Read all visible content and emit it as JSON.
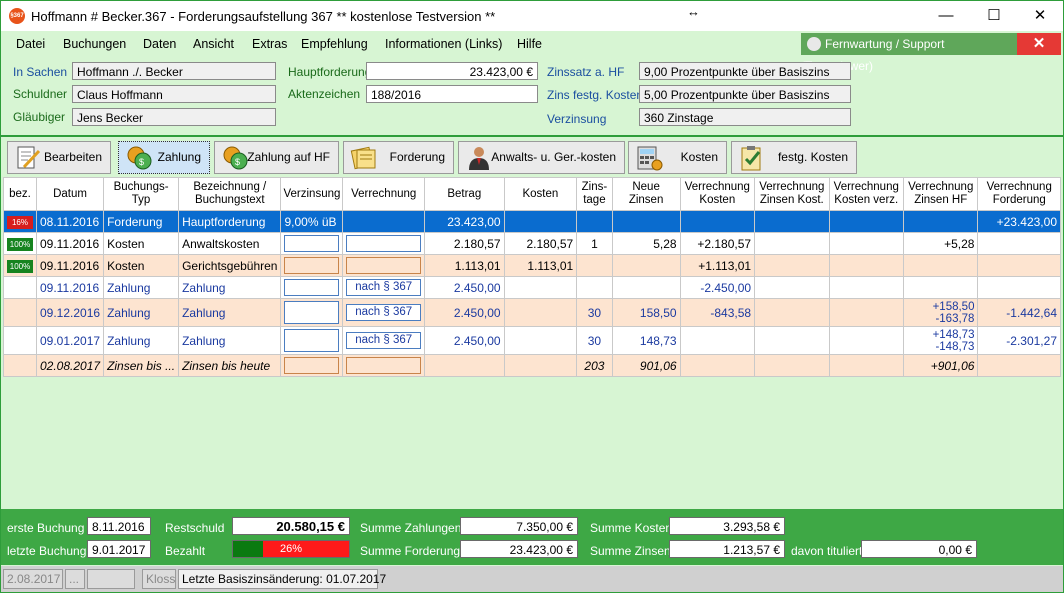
{
  "window": {
    "title": "Hoffmann # Becker.367 - Forderungsaufstellung 367 ** kostenlose Testversion **",
    "logo_text": "§367",
    "resize_glyph": "↔",
    "minimize": "—",
    "maximize": "☐",
    "close": "✕"
  },
  "menu": [
    "Datei",
    "Buchungen",
    "Daten",
    "Ansicht",
    "Extras",
    "Empfehlung",
    "Informationen (Links)",
    "Hilfe"
  ],
  "support": {
    "label": "Fernwartung / Support (Teamviewer)",
    "close": "✕"
  },
  "case": {
    "in_sachen_label": "In Sachen",
    "in_sachen": "Hoffmann ./. Becker",
    "schuldner_label": "Schuldner",
    "schuldner": "Claus Hoffmann",
    "glaeubiger_label": "Gläubiger",
    "glaeubiger": "Jens Becker",
    "hauptforderung_label": "Hauptforderung",
    "hauptforderung": "23.423,00 €",
    "aktenzeichen_label": "Aktenzeichen",
    "aktenzeichen": "188/2016",
    "zinssatz_label": "Zinssatz a. HF",
    "zinssatz": "9,00 Prozentpunkte über Basiszins",
    "zins_kosten_label": "Zins festg. Kosten",
    "zins_kosten": "5,00 Prozentpunkte über Basiszins",
    "verzinsung_label": "Verzinsung",
    "verzinsung": "360 Zinstage"
  },
  "toolbar": [
    "Bearbeiten",
    "Zahlung",
    "Zahlung auf HF",
    "Forderung",
    "Anwalts- u. Ger.-kosten",
    "Kosten",
    "festg. Kosten"
  ],
  "grid": {
    "headers": [
      "bez.",
      "Datum",
      "Buchungs-Typ",
      "Bezeichnung / Buchungstext",
      "Verzinsung",
      "Verrechnung",
      "Betrag",
      "Kosten",
      "Zins-tage",
      "Neue Zinsen",
      "Verrechnung Kosten",
      "Verrechnung Zinsen Kost.",
      "Verrechnung Kosten verz.",
      "Verrechnung Zinsen HF",
      "Verrechnung Forderung"
    ],
    "rows": [
      {
        "badge": "16%",
        "datum": "08.11.2016",
        "typ": "Forderung",
        "text": "Hauptforderung",
        "verz": "9,00%  üB",
        "verr": "",
        "betrag": "23.423,00",
        "kosten": "",
        "tage": "",
        "zinsen": "",
        "vk": "",
        "vzk": "",
        "vkv": "",
        "vzhf": "",
        "vf": "+23.423,00"
      },
      {
        "badge": "100%",
        "datum": "09.11.2016",
        "typ": "Kosten",
        "text": "Anwaltskosten",
        "verz": "",
        "verr": "",
        "betrag": "2.180,57",
        "kosten": "2.180,57",
        "tage": "1",
        "zinsen": "5,28",
        "vk": "+2.180,57",
        "vzk": "",
        "vkv": "",
        "vzhf": "+5,28",
        "vf": ""
      },
      {
        "badge": "100%",
        "datum": "09.11.2016",
        "typ": "Kosten",
        "text": "Gerichtsgebühren",
        "verz": "",
        "verr": "",
        "betrag": "1.113,01",
        "kosten": "1.113,01",
        "tage": "",
        "zinsen": "",
        "vk": "+1.113,01",
        "vzk": "",
        "vkv": "",
        "vzhf": "",
        "vf": ""
      },
      {
        "badge": "",
        "datum": "09.11.2016",
        "typ": "Zahlung",
        "text": "Zahlung",
        "verz": "",
        "verr": "nach § 367",
        "betrag": "2.450,00",
        "kosten": "",
        "tage": "",
        "zinsen": "",
        "vk": "-2.450,00",
        "vzk": "",
        "vkv": "",
        "vzhf": "",
        "vf": ""
      },
      {
        "badge": "",
        "datum": "09.12.2016",
        "typ": "Zahlung",
        "text": "Zahlung",
        "verz": "",
        "verr": "nach § 367",
        "betrag": "2.450,00",
        "kosten": "",
        "tage": "30",
        "zinsen": "158,50",
        "vk": "-843,58",
        "vzk": "",
        "vkv": "",
        "vzhf": "+158,50",
        "vzhf2": "-163,78",
        "vf": "-1.442,64"
      },
      {
        "badge": "",
        "datum": "09.01.2017",
        "typ": "Zahlung",
        "text": "Zahlung",
        "verz": "",
        "verr": "nach § 367",
        "betrag": "2.450,00",
        "kosten": "",
        "tage": "30",
        "zinsen": "148,73",
        "vk": "",
        "vzk": "",
        "vkv": "",
        "vzhf": "+148,73",
        "vzhf2": "-148,73",
        "vf": "-2.301,27"
      },
      {
        "badge": "",
        "datum": "02.08.2017",
        "typ": "Zinsen bis ...",
        "text": "Zinsen bis heute",
        "verz": "",
        "verr": "",
        "betrag": "",
        "kosten": "",
        "tage": "203",
        "zinsen": "901,06",
        "vk": "",
        "vzk": "",
        "vkv": "",
        "vzhf": "+901,06",
        "vf": ""
      }
    ]
  },
  "footer": {
    "erste_label": "erste Buchung",
    "erste": "8.11.2016",
    "letzte_label": "letzte Buchung",
    "letzte": "9.01.2017",
    "restschuld_label": "Restschuld",
    "restschuld": "20.580,15 €",
    "bezahlt_label": "Bezahlt",
    "bezahlt_pct": "26%",
    "bezahlt_fraction": 0.26,
    "sum_zahlungen_label": "Summe Zahlungen",
    "sum_zahlungen": "7.350,00 €",
    "sum_forderungen_label": "Summe Forderungen",
    "sum_forderungen": "23.423,00 €",
    "sum_kosten_label": "Summe Kosten",
    "sum_kosten": "3.293,58 €",
    "sum_zinsen_label": "Summe Zinsen",
    "sum_zinsen": "1.213,57 €",
    "tituliert_label": "davon tituliert",
    "tituliert": "0,00 €"
  },
  "status": {
    "date": "2.08.2017",
    "dots": "...",
    "empty": "",
    "user": "Kloss",
    "message": "Letzte Basiszinsänderung: 01.07.2017"
  }
}
